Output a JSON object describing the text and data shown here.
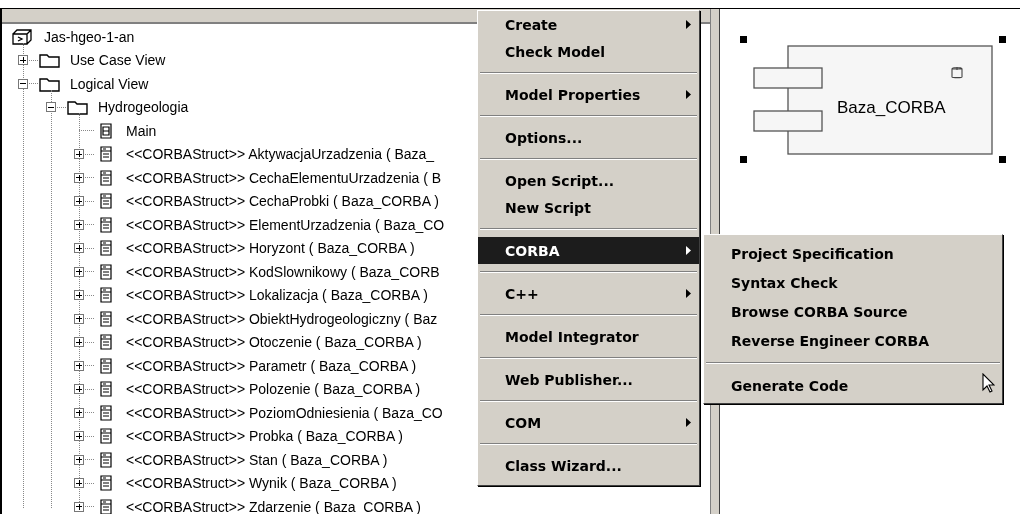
{
  "tree": {
    "label": "Jas-hgeo-1-an",
    "kind": "model",
    "children": [
      {
        "label": "Use Case View",
        "kind": "folder",
        "expanded": false
      },
      {
        "label": "Logical View",
        "kind": "folder",
        "expanded": true,
        "children": [
          {
            "label": "Hydrogeologia",
            "kind": "folder",
            "expanded": true,
            "children": [
              {
                "label": "Main",
                "kind": "diagram"
              },
              {
                "label": "<<CORBAStruct>> AktywacjaUrzadzenia ( Baza_",
                "kind": "class",
                "expanded": false
              },
              {
                "label": "<<CORBAStruct>> CechaElementuUrzadzenia ( B",
                "kind": "class",
                "expanded": false
              },
              {
                "label": "<<CORBAStruct>> CechaProbki ( Baza_CORBA )",
                "kind": "class",
                "expanded": false
              },
              {
                "label": "<<CORBAStruct>> ElementUrzadzenia ( Baza_CO",
                "kind": "class",
                "expanded": false
              },
              {
                "label": "<<CORBAStruct>> Horyzont ( Baza_CORBA )",
                "kind": "class",
                "expanded": false
              },
              {
                "label": "<<CORBAStruct>> KodSlownikowy ( Baza_CORB",
                "kind": "class",
                "expanded": false
              },
              {
                "label": "<<CORBAStruct>> Lokalizacja ( Baza_CORBA )",
                "kind": "class",
                "expanded": false
              },
              {
                "label": "<<CORBAStruct>> ObiektHydrogeologiczny ( Baz",
                "kind": "class",
                "expanded": false
              },
              {
                "label": "<<CORBAStruct>> Otoczenie ( Baza_CORBA )",
                "kind": "class",
                "expanded": false
              },
              {
                "label": "<<CORBAStruct>> Parametr ( Baza_CORBA )",
                "kind": "class",
                "expanded": false
              },
              {
                "label": "<<CORBAStruct>> Polozenie ( Baza_CORBA )",
                "kind": "class",
                "expanded": false
              },
              {
                "label": "<<CORBAStruct>> PoziomOdniesienia ( Baza_CO",
                "kind": "class",
                "expanded": false
              },
              {
                "label": "<<CORBAStruct>> Probka ( Baza_CORBA )",
                "kind": "class",
                "expanded": false
              },
              {
                "label": "<<CORBAStruct>> Stan ( Baza_CORBA )",
                "kind": "class",
                "expanded": false
              },
              {
                "label": "<<CORBAStruct>> Wynik ( Baza_CORBA )",
                "kind": "class",
                "expanded": false
              },
              {
                "label": "<<CORBAStruct>> Zdarzenie ( Baza_CORBA )",
                "kind": "class",
                "expanded": false
              }
            ]
          }
        ]
      }
    ]
  },
  "context_menu": {
    "groups": [
      [
        {
          "label": "Create",
          "has_submenu": true,
          "selected": false
        },
        {
          "label": "Check Model",
          "has_submenu": false,
          "selected": false
        }
      ],
      [
        {
          "label": "Model Properties",
          "has_submenu": true,
          "selected": false
        }
      ],
      [
        {
          "label": "Options...",
          "has_submenu": false,
          "selected": false
        }
      ],
      [
        {
          "label": "Open Script...",
          "has_submenu": false,
          "selected": false
        },
        {
          "label": "New Script",
          "has_submenu": false,
          "selected": false
        }
      ],
      [
        {
          "label": "CORBA",
          "has_submenu": true,
          "selected": true
        }
      ],
      [
        {
          "label": "C++",
          "has_submenu": true,
          "selected": false
        }
      ],
      [
        {
          "label": "Model Integrator",
          "has_submenu": false,
          "selected": false
        }
      ],
      [
        {
          "label": "Web Publisher...",
          "has_submenu": false,
          "selected": false
        }
      ],
      [
        {
          "label": "COM",
          "has_submenu": true,
          "selected": false
        }
      ],
      [
        {
          "label": "Class Wizard...",
          "has_submenu": false,
          "selected": false
        }
      ]
    ]
  },
  "submenu": {
    "groups": [
      [
        {
          "label": "Project Specification",
          "has_submenu": false,
          "selected": false
        },
        {
          "label": "Syntax Check",
          "has_submenu": false,
          "selected": false
        },
        {
          "label": "Browse CORBA Source",
          "has_submenu": false,
          "selected": false
        },
        {
          "label": "Reverse Engineer CORBA",
          "has_submenu": false,
          "selected": false
        }
      ],
      [
        {
          "label": "Generate Code",
          "has_submenu": false,
          "selected": false
        }
      ]
    ]
  },
  "diagram": {
    "component": {
      "name": "Baza_CORBA",
      "selected": true
    }
  }
}
